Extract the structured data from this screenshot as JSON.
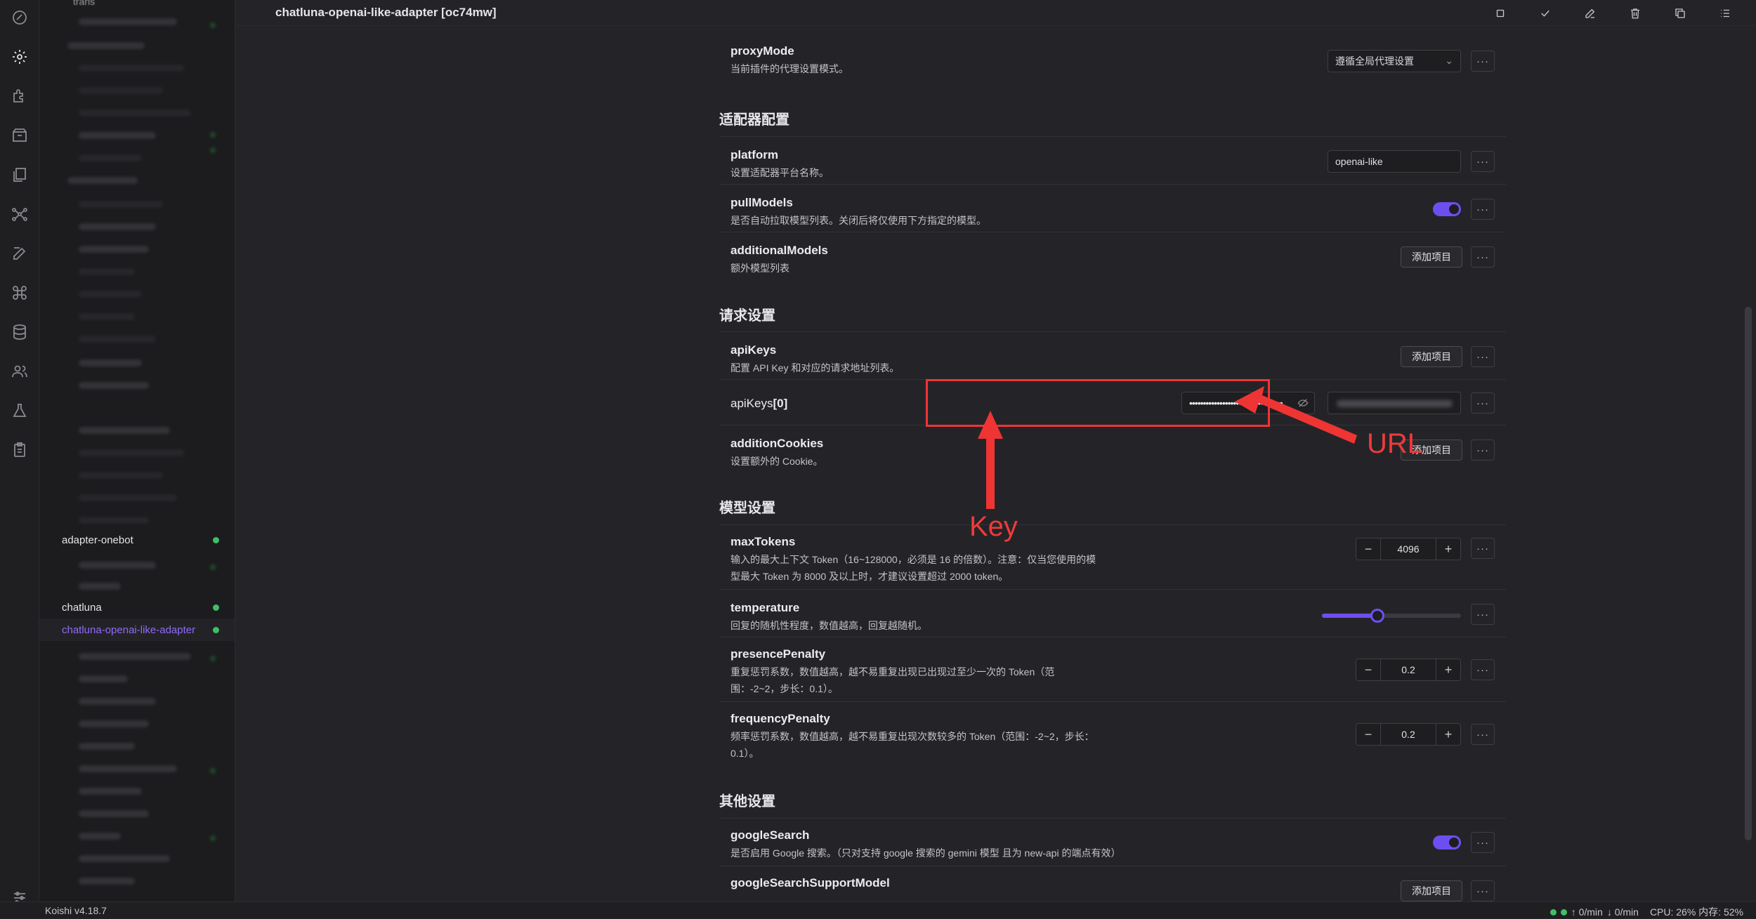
{
  "title": "chatluna-openai-like-adapter [oc74mw]",
  "status": {
    "version": "Koishi v4.18.7",
    "upload": "↑ 0/min",
    "download": "↓ 0/min",
    "usage": "CPU: 26% 内存: 52%"
  },
  "sidebar": {
    "top_partial": "trans",
    "plugins": [
      {
        "name": "adapter-onebot"
      },
      {
        "name": "chatluna"
      },
      {
        "name": "chatluna-openai-like-adapter",
        "selected": true
      }
    ]
  },
  "toolbar_icons": [
    "stop-icon",
    "check-icon",
    "edit-icon",
    "trash-icon",
    "copy-icon",
    "list-icon"
  ],
  "activity_icons": [
    "dashboard-icon",
    "gear-icon",
    "puzzle-icon",
    "box-icon",
    "files-icon",
    "network-icon",
    "edit-icon",
    "command-icon",
    "database-icon",
    "users-icon",
    "flask-icon",
    "clipboard-icon",
    "sliders-icon"
  ],
  "settings": {
    "proxyMode": {
      "name": "proxyMode",
      "desc": "当前插件的代理设置模式。",
      "value": "遵循全局代理设置"
    },
    "adapter_section": "适配器配置",
    "platform": {
      "name": "platform",
      "desc": "设置适配器平台名称。",
      "value": "openai-like"
    },
    "pullModels": {
      "name": "pullModels",
      "desc": "是否自动拉取模型列表。关闭后将仅使用下方指定的模型。",
      "enabled": true
    },
    "additionalModels": {
      "name": "additionalModels",
      "desc": "额外模型列表",
      "button": "添加项目"
    },
    "request_section": "请求设置",
    "apiKeys": {
      "name": "apiKeys",
      "desc": "配置 API Key 和对应的请求地址列表。",
      "button": "添加项目"
    },
    "apiKeys0": {
      "name": "apiKeys",
      "index": "[0]",
      "key_value": "••••••••••••••••••••••••••••••••••"
    },
    "additionCookies": {
      "name": "additionCookies",
      "desc": "设置额外的 Cookie。",
      "button": "添加项目"
    },
    "model_section": "模型设置",
    "maxTokens": {
      "name": "maxTokens",
      "desc1": "输入的最大上下文 Token（16~128000，必须是 16 的倍数）。注意：仅当您使用的模",
      "desc2": "型最大 Token 为 8000 及以上时，才建议设置超过 2000 token。",
      "value": "4096"
    },
    "temperature": {
      "name": "temperature",
      "desc": "回复的随机性程度，数值越高，回复越随机。",
      "value": 0.4
    },
    "presencePenalty": {
      "name": "presencePenalty",
      "desc1": "重复惩罚系数，数值越高，越不易重复出现已出现过至少一次的 Token（范",
      "desc2": "围：-2~2，步长：0.1）。",
      "value": "0.2"
    },
    "frequencyPenalty": {
      "name": "frequencyPenalty",
      "desc1": "频率惩罚系数，数值越高，越不易重复出现次数较多的 Token（范围：-2~2，步长：",
      "desc2": "0.1）。",
      "value": "0.2"
    },
    "other_section": "其他设置",
    "googleSearch": {
      "name": "googleSearch",
      "desc": "是否启用 Google 搜索。（只对支持 google 搜索的 gemini 模型 且为 new-api 的端点有效）",
      "enabled": true
    },
    "googleSearchSupportModel": {
      "name": "googleSearchSupportModel",
      "button": "添加项目"
    },
    "more": "···"
  },
  "annotations": {
    "key_label": "Key",
    "url_label": "URL",
    "color": "#ef3434"
  },
  "colors": {
    "accent": "#6d4ff0",
    "status_green": "#3fbf64",
    "selected_plugin": "#8d6cf7"
  }
}
